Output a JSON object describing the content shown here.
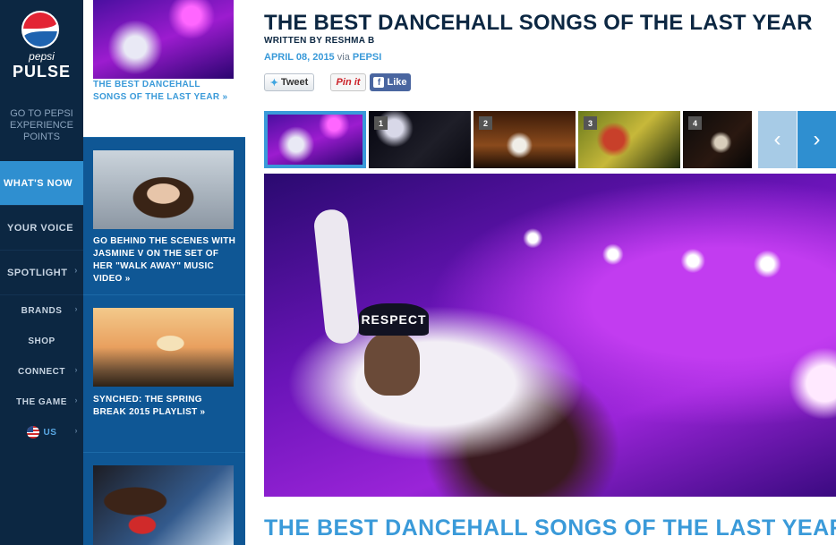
{
  "brand": {
    "top": "pepsi",
    "name": "PULSE"
  },
  "points_link": "GO TO PEPSI EXPERIENCE POINTS",
  "nav_main": [
    {
      "label": "WHAT'S NOW",
      "active": true
    },
    {
      "label": "YOUR VOICE",
      "active": false
    },
    {
      "label": "SPOTLIGHT",
      "active": false
    }
  ],
  "nav_sub": [
    {
      "label": "BRANDS"
    },
    {
      "label": "SHOP"
    },
    {
      "label": "CONNECT"
    },
    {
      "label": "THE GAME"
    },
    {
      "label": "US",
      "icon": "us-flag-icon"
    }
  ],
  "stories": [
    {
      "title": "THE BEST DANCEHALL SONGS OF THE LAST YEAR »",
      "current": true
    },
    {
      "title": "GO BEHIND THE SCENES WITH JASMINE V ON THE SET OF HER \"WALK AWAY\" MUSIC VIDEO »",
      "current": false
    },
    {
      "title": "SYNCHED: THE SPRING BREAK 2015 PLAYLIST »",
      "current": false
    },
    {
      "title": "",
      "current": false
    }
  ],
  "article": {
    "headline": "THE BEST DANCEHALL SONGS OF THE LAST YEAR",
    "byline": "WRITTEN BY RESHMA B",
    "date": "APRIL 08, 2015",
    "via": "via",
    "source": "PEPSI",
    "subhead": "THE BEST DANCEHALL SONGS OF THE LAST YEAR"
  },
  "social": {
    "tweet": "Tweet",
    "pin": "Pin it",
    "like": "Like"
  },
  "gallery": {
    "numbers": [
      "1",
      "2",
      "3",
      "4"
    ],
    "prev_icon": "chevron-left-icon",
    "next_icon": "chevron-right-icon"
  },
  "hero": {
    "cap_text": "RESPECT"
  },
  "colors": {
    "nav_bg": "#0c2742",
    "stories_bg": "#0f5795",
    "accent": "#3a9ad9",
    "active_nav": "#2f8fd0"
  }
}
